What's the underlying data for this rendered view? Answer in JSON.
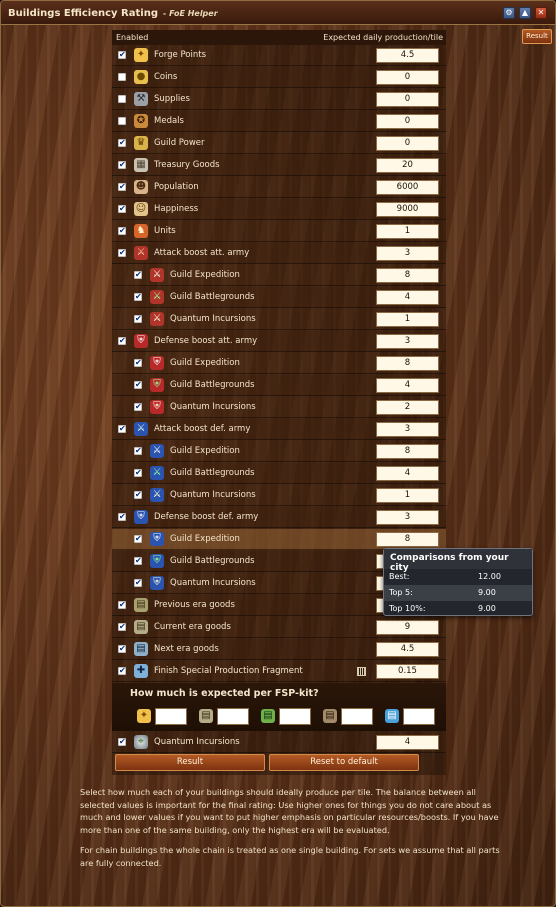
{
  "window": {
    "title": "Buildings Efficiency Rating",
    "subtitle": "- FoE Helper",
    "controls": [
      "gear-icon",
      "minimize-icon",
      "close-icon"
    ]
  },
  "top_result_label": "Result",
  "table": {
    "col_enabled": "Enabled",
    "col_expected": "Expected daily production/tile"
  },
  "rows": [
    {
      "label": "Forge Points",
      "value": "4.5",
      "checked": true,
      "indent": 0,
      "icon": "forge-points-icon"
    },
    {
      "label": "Coins",
      "value": "0",
      "checked": false,
      "indent": 0,
      "icon": "coins-icon"
    },
    {
      "label": "Supplies",
      "value": "0",
      "checked": false,
      "indent": 0,
      "icon": "supplies-icon"
    },
    {
      "label": "Medals",
      "value": "0",
      "checked": false,
      "indent": 0,
      "icon": "medals-icon"
    },
    {
      "label": "Guild Power",
      "value": "0",
      "checked": true,
      "indent": 0,
      "icon": "guild-power-icon"
    },
    {
      "label": "Treasury Goods",
      "value": "20",
      "checked": true,
      "indent": 0,
      "icon": "treasury-goods-icon"
    },
    {
      "label": "Population",
      "value": "6000",
      "checked": true,
      "indent": 0,
      "icon": "population-icon"
    },
    {
      "label": "Happiness",
      "value": "9000",
      "checked": true,
      "indent": 0,
      "icon": "happiness-icon"
    },
    {
      "label": "Units",
      "value": "1",
      "checked": true,
      "indent": 0,
      "icon": "units-icon"
    },
    {
      "label": "Attack boost att. army",
      "value": "3",
      "checked": true,
      "indent": 0,
      "icon": "attack-att-icon"
    },
    {
      "label": "Guild Expedition",
      "value": "8",
      "checked": true,
      "indent": 1,
      "icon": "attack-att-ge-icon"
    },
    {
      "label": "Guild Battlegrounds",
      "value": "4",
      "checked": true,
      "indent": 1,
      "icon": "attack-att-gbg-icon"
    },
    {
      "label": "Quantum Incursions",
      "value": "1",
      "checked": true,
      "indent": 1,
      "icon": "attack-att-qi-icon"
    },
    {
      "label": "Defense boost att. army",
      "value": "3",
      "checked": true,
      "indent": 0,
      "icon": "defense-att-icon"
    },
    {
      "label": "Guild Expedition",
      "value": "8",
      "checked": true,
      "indent": 1,
      "icon": "defense-att-ge-icon"
    },
    {
      "label": "Guild Battlegrounds",
      "value": "4",
      "checked": true,
      "indent": 1,
      "icon": "defense-att-gbg-icon"
    },
    {
      "label": "Quantum Incursions",
      "value": "2",
      "checked": true,
      "indent": 1,
      "icon": "defense-att-qi-icon"
    },
    {
      "label": "Attack boost def. army",
      "value": "3",
      "checked": true,
      "indent": 0,
      "icon": "attack-def-icon"
    },
    {
      "label": "Guild Expedition",
      "value": "8",
      "checked": true,
      "indent": 1,
      "icon": "attack-def-ge-icon"
    },
    {
      "label": "Guild Battlegrounds",
      "value": "4",
      "checked": true,
      "indent": 1,
      "icon": "attack-def-gbg-icon"
    },
    {
      "label": "Quantum Incursions",
      "value": "1",
      "checked": true,
      "indent": 1,
      "icon": "attack-def-qi-icon"
    },
    {
      "label": "Defense boost def. army",
      "value": "3",
      "checked": true,
      "indent": 0,
      "icon": "defense-def-icon"
    },
    {
      "label": "Guild Expedition",
      "value": "8",
      "checked": true,
      "indent": 1,
      "icon": "defense-def-ge-icon",
      "highlight": true
    },
    {
      "label": "Guild Battlegrounds",
      "value": "",
      "checked": true,
      "indent": 1,
      "icon": "defense-def-gbg-icon"
    },
    {
      "label": "Quantum Incursions",
      "value": "",
      "checked": true,
      "indent": 1,
      "icon": "defense-def-qi-icon"
    },
    {
      "label": "Previous era goods",
      "value": "",
      "checked": true,
      "indent": 0,
      "icon": "previous-era-goods-icon"
    },
    {
      "label": "Current era goods",
      "value": "9",
      "checked": true,
      "indent": 0,
      "icon": "current-era-goods-icon"
    },
    {
      "label": "Next era goods",
      "value": "4.5",
      "checked": true,
      "indent": 0,
      "icon": "next-era-goods-icon"
    },
    {
      "label": "Finish Special Production Fragment",
      "value": "0.15",
      "checked": true,
      "indent": 0,
      "icon": "fsp-fragment-icon",
      "grid_icon": true
    }
  ],
  "fsp": {
    "title": "How much is expected per FSP-kit?",
    "items": [
      {
        "icon": "forge-points-icon",
        "value": ""
      },
      {
        "icon": "goods-icon",
        "value": ""
      },
      {
        "icon": "green-goods-icon",
        "value": ""
      },
      {
        "icon": "crate-goods-icon",
        "value": ""
      },
      {
        "icon": "blue-goods-icon",
        "value": ""
      }
    ]
  },
  "last_row": {
    "label": "Quantum Incursions",
    "value": "4",
    "checked": true,
    "icon": "quantum-incursions-icon"
  },
  "buttons": {
    "result": "Result",
    "reset": "Reset to default"
  },
  "description": {
    "p1": "Select how much each of your buildings should ideally produce per tile. The balance between all selected values is important for the final rating: Use higher ones for things you do not care about as much and lower values if you want to put higher emphasis on particular resources/boosts. If you have more than one of the same building, only the highest era will be evaluated.",
    "p2": "For chain buildings the whole chain is treated as one single building. For sets we assume that all parts are fully connected."
  },
  "tooltip": {
    "title": "Comparisons from your city",
    "rows": [
      {
        "key": "Best:",
        "value": "12.00"
      },
      {
        "key": "Top 5:",
        "value": "9.00"
      },
      {
        "key": "Top 10%:",
        "value": "9.00"
      }
    ]
  }
}
